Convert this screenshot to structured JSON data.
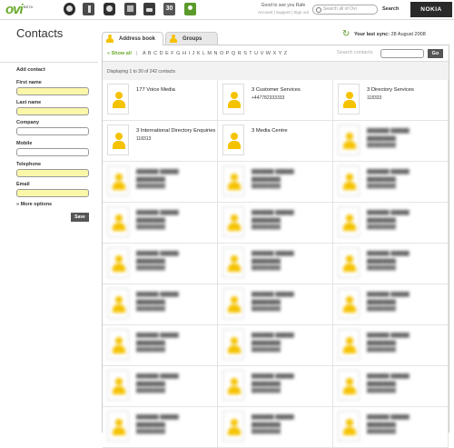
{
  "topbar": {
    "logo": "ovi",
    "logo_badge": "BETA",
    "apps": [
      "globe-icon",
      "music-icon",
      "photo-icon",
      "files-icon",
      "folder-icon",
      "calendar-icon",
      "contacts-icon"
    ],
    "calendar_label": "30",
    "greeting": "Good to see you Rafe",
    "links": [
      "Account",
      "Support",
      "Sign out"
    ],
    "search_placeholder": "Search all of Ovi",
    "search_button": "Search",
    "brand": "NOKIA"
  },
  "page_title": "Contacts",
  "sidebar": {
    "heading": "Add contact",
    "fields": [
      {
        "label": "First name",
        "required": true,
        "value": ""
      },
      {
        "label": "Last name",
        "required": true,
        "value": ""
      },
      {
        "label": "Company",
        "required": false,
        "value": ""
      },
      {
        "label": "Mobile",
        "required": false,
        "value": ""
      },
      {
        "label": "Telephone",
        "required": true,
        "value": ""
      },
      {
        "label": "Email",
        "required": true,
        "value": ""
      }
    ],
    "more_options": "» More options",
    "save_button": "Save"
  },
  "tabs": [
    {
      "label": "Address book",
      "active": true
    },
    {
      "label": "Groups",
      "active": false
    }
  ],
  "sync": {
    "label": "Your last sync:",
    "date": "28 August 2008"
  },
  "alpha": {
    "show_all": "« Show all",
    "separator": "|",
    "letters": "A B C D E F G H I J K L M N O P Q R S T U V W X Y Z",
    "search_placeholder": "Search contacts",
    "go_button": "Go"
  },
  "displaying": "Displaying 1 to 30 of 242 contacts",
  "contacts": [
    {
      "name": "177 Voice Media",
      "phone": ""
    },
    {
      "name": "3 Customer Services",
      "phone": "+447782333333"
    },
    {
      "name": "3 Directory Services",
      "phone": "118333"
    },
    {
      "name": "3 International Directory Enquiries",
      "phone": "118313"
    },
    {
      "name": "3 Media Centre",
      "phone": ""
    }
  ],
  "blurred_rows": 7,
  "colors": {
    "accent_green": "#69aa2a",
    "required_field": "#fbf7a8",
    "avatar": "#f5c200",
    "dark_button": "#555555"
  }
}
